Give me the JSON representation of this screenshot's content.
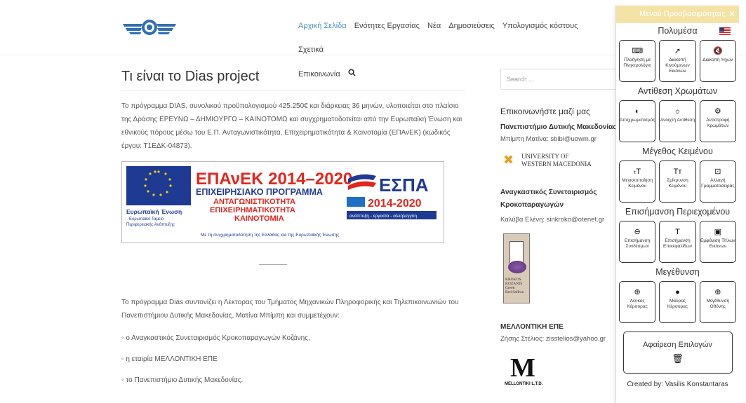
{
  "header": {
    "nav": [
      "Αρχική Σελίδα",
      "Ενότητες Εργασίας",
      "Νέα",
      "Δημοσιεύσεις",
      "Υπολογισμός κόστους",
      "Σχετικά",
      "Επικοινωνία"
    ],
    "search_icon": "search-icon"
  },
  "main": {
    "title": "Τι είναι το Dias project",
    "para1": "Το πρόγραμμα DIAS, συνολικού προϋπολογισμού 425.250€ και διάρκειας 36 μηνών, υλοποιείται στο πλαίσιο της Δράσης ΕΡΕΥΝΩ – ΔΗΜΙΟΥΡΓΩ – ΚΑΙΝΟΤΟΜΩ και συγχρηματοδοτείται από την Ευρωπαϊκή Ένωση και εθνικούς πόρους μέσω του Ε.Π. Ανταγωνιστικότητα, Επιχειρηματικότητα & Καινοτομία (ΕΠΑνΕΚ) (κωδικός έργου: Τ1ΕΔΚ-04873).",
    "banner": {
      "epanek": "ΕΠΑνΕΚ 2014–2020",
      "program": "ΕΠΙΧΕΙΡΗΣΙΑΚΟ ΠΡΟΓΡΑΜΜΑ",
      "l1": "ΑΝΤΑΓΩΝΙΣΤΙΚΟΤΗΤΑ",
      "l2": "ΕΠΙΧΕΙΡΗΜΑΤΙΚΟΤΗΤΑ",
      "l3": "ΚΑΙΝΟΤΟΜΙΑ",
      "espa": "ΕΣΠΑ",
      "espa_years": "2014-2020",
      "espa_tag": "ανάπτυξη - εργασία - αλληλεγγύη",
      "eu": "Ευρωπαϊκή Ένωση",
      "eu_sub1": "Ευρωπαϊκό Ταμείο",
      "eu_sub2": "Περιφερειακής Ανάπτυξης",
      "footer": "Με τη συγχρηματοδότηση της Ελλάδας και της Ευρωπαϊκής Ένωσης"
    },
    "para2": "Το πρόγραμμα Dias συντονίζει η Λέκτορας του Τμήματος Μηχανικών Πληροφορικής και Τηλεπικοινωνιών του Πανεπιστήμιου Δυτικής Μακεδονίας, Ματίνα Μπίμπη και συμμετέχουν:",
    "list": [
      "ο Αναγκαστικός Συνεταιρισμός Κροκοπαραγωγών Κοζάνης,",
      "η εταιρία ΜΕΛΛΟΝΤΙΚΗ ΕΠΕ",
      "το Πανεπιστήμιο Δυτικής Μακεδονίας."
    ]
  },
  "sidebar": {
    "search_placeholder": "Search ...",
    "contact_title": "Επικοινωνήστε μαζί μας",
    "uowm": "Πανεπιστήμιο Δυτικής Μακεδονίας",
    "uowm_contact": "Μπίμπη Ματίνα: sbibi@uowm.gr",
    "uowm_logo1": "UNIVERSITY OF",
    "uowm_logo2": "WESTERN MACEDONIA",
    "coop1": "Αναγκαστικός Συνεταιρισμός",
    "coop2": "Κροκοπαραγωγών",
    "coop_contact": "Καλύβα Ελένη: sinkroko@otenet.gr",
    "krokos": "KROKOS KOZANIS",
    "krokos_sub1": "Greek",
    "krokos_sub2": "Red Saffron",
    "mel_title": "ΜΕΛΛΟΝΤΙΚΗ ΕΠΕ",
    "mel_contact": "Ζήσης Στέλιος: zisstelios@yahoo.gr",
    "mel_logo": "M",
    "mel_logo_text": "MELLONTIKI L.T.D."
  },
  "accessibility": {
    "title": "Μενού Προσβασιμότητας",
    "close": "✕",
    "sections": [
      {
        "title": "Πολυμέσα",
        "buttons": [
          {
            "icon": "keyboard-icon",
            "glyph": "⌨",
            "label": "Πλοήγηση με Πληκτρολόγιο"
          },
          {
            "icon": "pointer-off-icon",
            "glyph": "➚",
            "label": "Διακοπή Κινούμενων Εικόνων"
          },
          {
            "icon": "mute-icon",
            "glyph": "🔇",
            "label": "Διακοπή Ήχων"
          }
        ]
      },
      {
        "title": "Αντίθεση Χρωμάτων",
        "buttons": [
          {
            "icon": "contrast-icon",
            "glyph": "◐",
            "label": "Αποχρωματισμός"
          },
          {
            "icon": "brightness-icon",
            "glyph": "☼",
            "label": "Ανοιχτή Αντίθεση"
          },
          {
            "icon": "invert-icon",
            "glyph": "⚙",
            "label": "Αντιστροφή Χρωμάτων"
          }
        ]
      },
      {
        "title": "Μέγεθος Κειμένου",
        "buttons": [
          {
            "icon": "text-decrease-icon",
            "glyph": "ₜT",
            "label": "Μεγιστοποίηση Κειμένου"
          },
          {
            "icon": "text-shrink-icon",
            "glyph": "Tт",
            "label": "Σμίκρυνση Κειμένου"
          },
          {
            "icon": "font-change-icon",
            "glyph": "⊡",
            "label": "Αλλαγή Γραμματοσειράς"
          }
        ]
      },
      {
        "title": "Επισήμανση Περιεχομένου",
        "buttons": [
          {
            "icon": "link-icon",
            "glyph": "⊖",
            "label": "Επισήμανση Συνδέσμων"
          },
          {
            "icon": "heading-icon",
            "glyph": "T",
            "label": "Επισήμανση Επικεφαλίδων"
          },
          {
            "icon": "image-icon",
            "glyph": "▣",
            "label": "Εμφάνιση Τίτλων Εικόνων"
          }
        ]
      },
      {
        "title": "Μεγέθυνση",
        "buttons": [
          {
            "icon": "white-cursor-icon",
            "glyph": "⊕",
            "label": "Λευκός Κέρσορας"
          },
          {
            "icon": "black-cursor-icon",
            "glyph": "●",
            "label": "Μαύρος Κέρσορας"
          },
          {
            "icon": "zoom-icon",
            "glyph": "⊕",
            "label": "Μεγέθυνση Οθόνης"
          }
        ]
      }
    ],
    "reset_label": "Αφαίρεση Επιλογών",
    "reset_icon": "trash-icon",
    "credit": "Created by: Vasilis Konstantaras"
  }
}
